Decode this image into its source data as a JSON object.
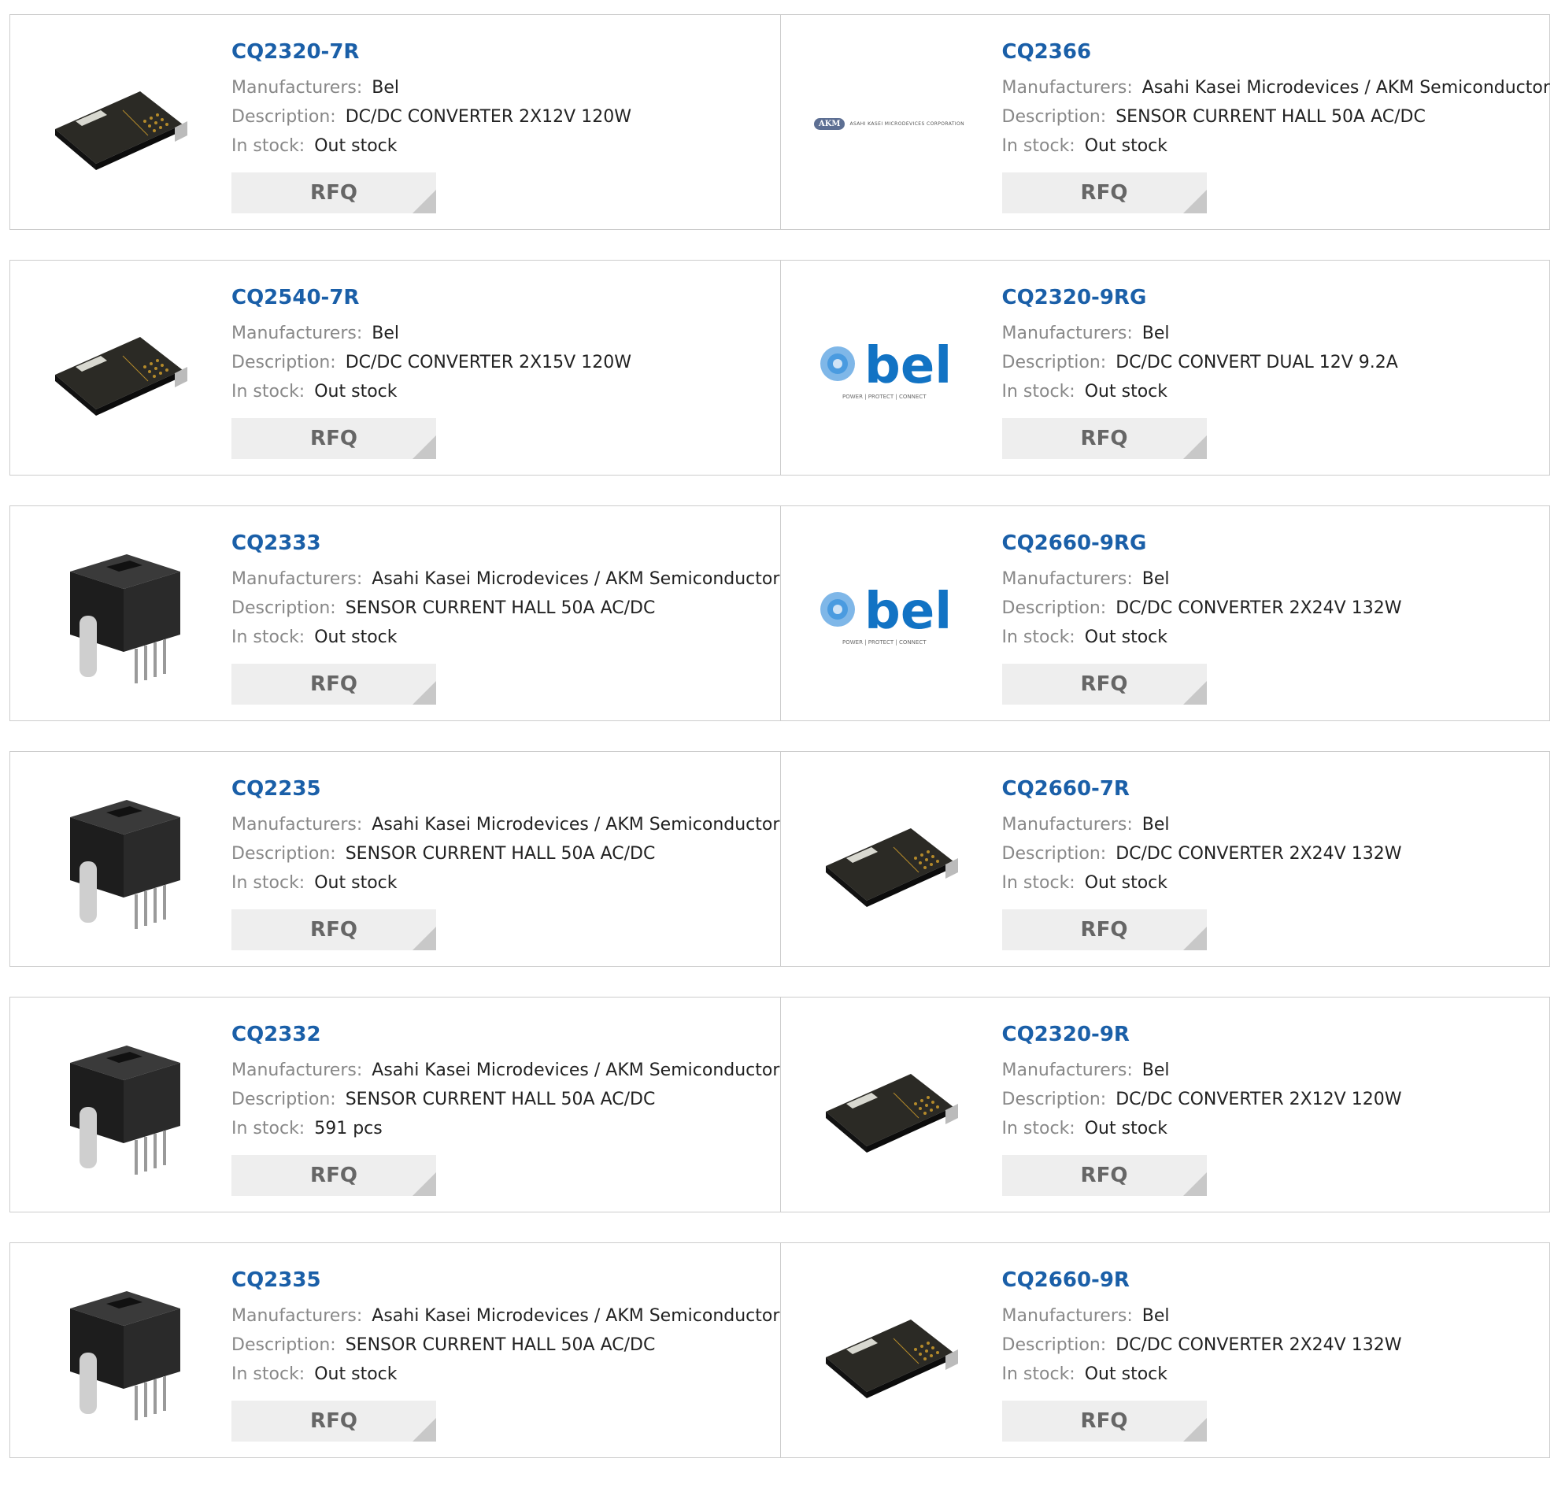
{
  "labels": {
    "manufacturers": "Manufacturers:",
    "description": "Description:",
    "in_stock": "In stock:",
    "rfq": "RFQ"
  },
  "logos": {
    "bel_word": "bel",
    "bel_tagline": "POWER | PROTECT | CONNECT",
    "akm_mark": "AKM",
    "akm_name": "ASAHI KASEI MICRODEVICES CORPORATION"
  },
  "colors": {
    "link": "#1a5fa8",
    "label": "#888888",
    "button_bg": "#eeeeee",
    "border": "#cccccc",
    "bel_blue": "#1273c4"
  },
  "products": [
    {
      "part": "CQ2320-7R",
      "manufacturer": "Bel",
      "description": "DC/DC CONVERTER 2X12V 120W",
      "stock": "Out stock",
      "image": "dcdc-module"
    },
    {
      "part": "CQ2366",
      "manufacturer": "Asahi Kasei Microdevices / AKM Semiconductor",
      "description": "SENSOR CURRENT HALL 50A AC/DC",
      "stock": "Out stock",
      "image": "akm-logo"
    },
    {
      "part": "CQ2540-7R",
      "manufacturer": "Bel",
      "description": "DC/DC CONVERTER 2X15V 120W",
      "stock": "Out stock",
      "image": "dcdc-module"
    },
    {
      "part": "CQ2320-9RG",
      "manufacturer": "Bel",
      "description": "DC/DC CONVERT DUAL 12V 9.2A",
      "stock": "Out stock",
      "image": "bel-logo"
    },
    {
      "part": "CQ2333",
      "manufacturer": "Asahi Kasei Microdevices / AKM Semiconductor",
      "description": "SENSOR CURRENT HALL 50A AC/DC",
      "stock": "Out stock",
      "image": "hall-sensor"
    },
    {
      "part": "CQ2660-9RG",
      "manufacturer": "Bel",
      "description": "DC/DC CONVERTER 2X24V 132W",
      "stock": "Out stock",
      "image": "bel-logo"
    },
    {
      "part": "CQ2235",
      "manufacturer": "Asahi Kasei Microdevices / AKM Semiconductor",
      "description": "SENSOR CURRENT HALL 50A AC/DC",
      "stock": "Out stock",
      "image": "hall-sensor"
    },
    {
      "part": "CQ2660-7R",
      "manufacturer": "Bel",
      "description": "DC/DC CONVERTER 2X24V 132W",
      "stock": "Out stock",
      "image": "dcdc-module"
    },
    {
      "part": "CQ2332",
      "manufacturer": "Asahi Kasei Microdevices / AKM Semiconductor",
      "description": "SENSOR CURRENT HALL 50A AC/DC",
      "stock": "591 pcs",
      "image": "hall-sensor"
    },
    {
      "part": "CQ2320-9R",
      "manufacturer": "Bel",
      "description": "DC/DC CONVERTER 2X12V 120W",
      "stock": "Out stock",
      "image": "dcdc-module"
    },
    {
      "part": "CQ2335",
      "manufacturer": "Asahi Kasei Microdevices / AKM Semiconductor",
      "description": "SENSOR CURRENT HALL 50A AC/DC",
      "stock": "Out stock",
      "image": "hall-sensor"
    },
    {
      "part": "CQ2660-9R",
      "manufacturer": "Bel",
      "description": "DC/DC CONVERTER 2X24V 132W",
      "stock": "Out stock",
      "image": "dcdc-module"
    }
  ]
}
